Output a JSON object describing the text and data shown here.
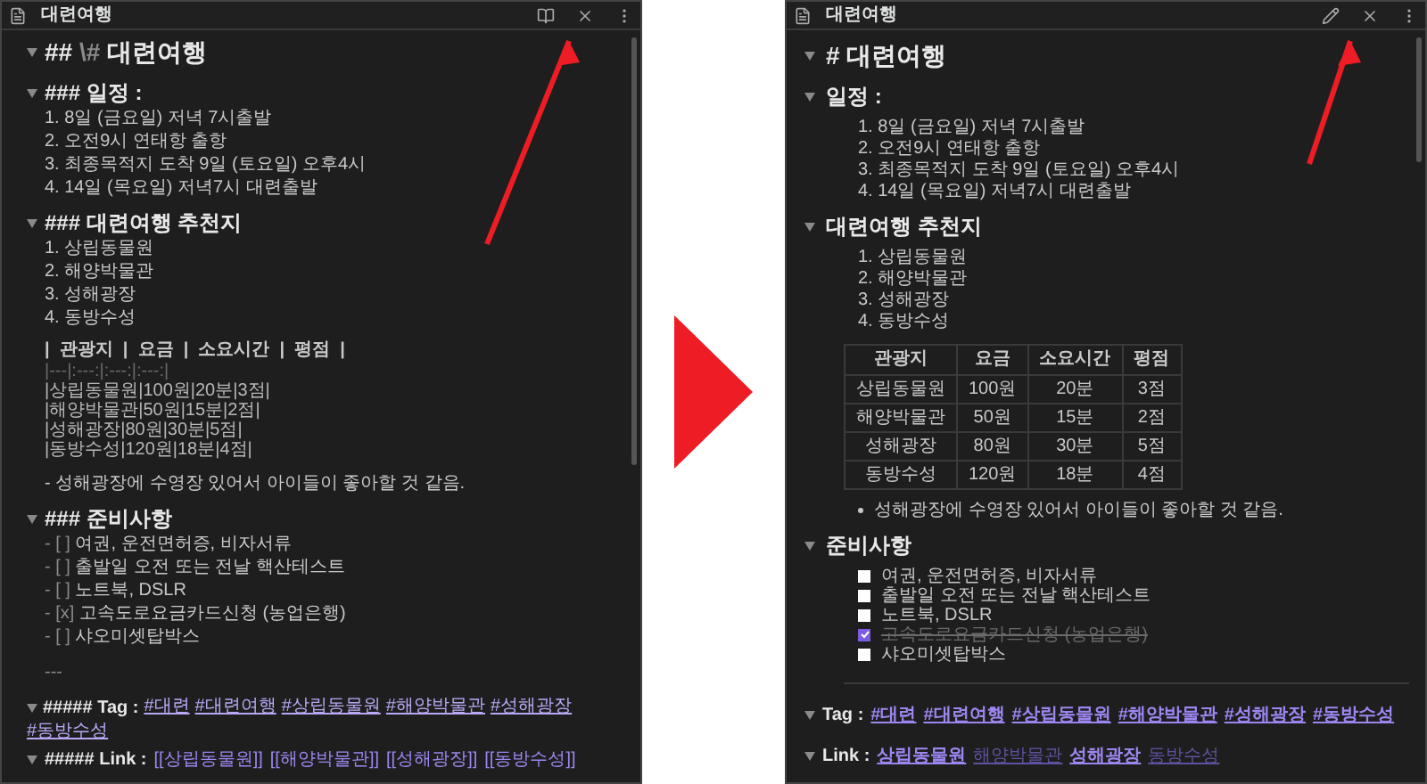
{
  "source_pane": {
    "title": "대련여행",
    "kind": "source",
    "lines": [
      {
        "kind": "title",
        "marker": "##",
        "escape": "\\#",
        "text": "대련여행"
      },
      {
        "kind": "heading",
        "marker": "###",
        "text": "일정 :"
      },
      {
        "kind": "item",
        "text": "1. 8일 (금요일) 저녁 7시출발"
      },
      {
        "kind": "item",
        "text": "2. 오전9시 연태항 출항"
      },
      {
        "kind": "item",
        "text": "3. 최종목적지 도착 9일 (토요일) 오후4시"
      },
      {
        "kind": "item",
        "text": "4. 14일 (목요일) 저녁7시 대련출발"
      },
      {
        "kind": "heading",
        "marker": "###",
        "text": "대련여행 추천지"
      },
      {
        "kind": "item",
        "text": "1. 상립동물원"
      },
      {
        "kind": "item",
        "text": "2. 해양박물관"
      },
      {
        "kind": "item",
        "text": "3. 성해광장"
      },
      {
        "kind": "item",
        "text": "4. 동방수성"
      },
      {
        "kind": "table_header",
        "text": "|  관광지  |  요금  |  소요시간  |  평점  |"
      },
      {
        "kind": "table_rule",
        "text": "|---|:---:|:---:|:---:|"
      },
      {
        "kind": "table_row",
        "text": "|상립동물원|100원|20분|3점|"
      },
      {
        "kind": "table_row",
        "text": "|해양박물관|50원|15분|2점|"
      },
      {
        "kind": "table_row",
        "text": "|성해광장|80원|30분|5점|"
      },
      {
        "kind": "table_row",
        "text": "|동방수성|120원|18분|4점|"
      },
      {
        "kind": "bullet",
        "text": "- 성해광장에 수영장 있어서 아이들이 좋아할 것 같음."
      },
      {
        "kind": "heading",
        "marker": "###",
        "text": "준비사항"
      },
      {
        "kind": "task",
        "mark": "- [ ]",
        "text": "여권, 운전면허증, 비자서류"
      },
      {
        "kind": "task",
        "mark": "- [ ]",
        "text": "출발일 오전 또는 전날 핵산테스트"
      },
      {
        "kind": "task",
        "mark": "- [ ]",
        "text": "노트북, DSLR"
      },
      {
        "kind": "task",
        "mark": "- [x]",
        "text": "고속도로요금카드신청 (농업은행)"
      },
      {
        "kind": "task",
        "mark": "- [ ]",
        "text": "샤오미셋탑박스"
      },
      {
        "kind": "rule",
        "text": "---"
      },
      {
        "kind": "tags",
        "marker": "##### Tag :",
        "tags": [
          "#대련",
          "#대련여행",
          "#상립동물원",
          "#해양박물관",
          "#성해광장",
          "#동방수성"
        ]
      },
      {
        "kind": "links",
        "marker": "##### Link :",
        "links": [
          "[[상립동물원]]",
          "[[해양박물관]]",
          "[[성해광장]]",
          "[[동방수성]]"
        ]
      }
    ]
  },
  "preview_pane": {
    "title": "대련여행",
    "kind": "preview",
    "blocks": [
      {
        "kind": "title",
        "text": "# 대련여행"
      },
      {
        "kind": "heading",
        "text": "일정 :"
      },
      {
        "kind": "ordered_list",
        "items": [
          "1. 8일 (금요일) 저녁 7시출발",
          "2. 오전9시 연태항 출항",
          "3. 최종목적지 도착 9일 (토요일) 오후4시",
          "4. 14일 (목요일) 저녁7시 대련출발"
        ]
      },
      {
        "kind": "heading",
        "text": "대련여행 추천지"
      },
      {
        "kind": "ordered_list",
        "items": [
          "1. 상립동물원",
          "2. 해양박물관",
          "3. 성해광장",
          "4. 동방수성"
        ]
      },
      {
        "kind": "table",
        "columns": [
          "관광지",
          "요금",
          "소요시간",
          "평점"
        ],
        "rows": [
          [
            "상립동물원",
            "100원",
            "20분",
            "3점"
          ],
          [
            "해양박물관",
            "50원",
            "15분",
            "2점"
          ],
          [
            "성해광장",
            "80원",
            "30분",
            "5점"
          ],
          [
            "동방수성",
            "120원",
            "18분",
            "4점"
          ]
        ]
      },
      {
        "kind": "bullet_list",
        "items": [
          "성해광장에 수영장 있어서 아이들이 좋아할 것 같음."
        ]
      },
      {
        "kind": "heading",
        "text": "준비사항"
      },
      {
        "kind": "task_list",
        "items": [
          {
            "text": "여권, 운전면허증, 비자서류",
            "checked": false
          },
          {
            "text": "출발일 오전 또는 전날 핵산테스트",
            "checked": false
          },
          {
            "text": "노트북, DSLR",
            "checked": false
          },
          {
            "text": "고속도로요금카드신청 (농업은행)",
            "checked": true
          },
          {
            "text": "샤오미셋탑박스",
            "checked": false
          }
        ]
      },
      {
        "kind": "rule"
      },
      {
        "kind": "tags",
        "label": "Tag :",
        "tags": [
          "#대련",
          "#대련여행",
          "#상립동물원",
          "#해양박물관",
          "#성해광장",
          "#동방수성"
        ]
      },
      {
        "kind": "links",
        "label": "Link :",
        "links": [
          {
            "text": "상립동물원",
            "resolved": true
          },
          {
            "text": "해양박물관",
            "resolved": false
          },
          {
            "text": "성해광장",
            "resolved": true
          },
          {
            "text": "동방수성",
            "resolved": false
          }
        ]
      }
    ]
  }
}
